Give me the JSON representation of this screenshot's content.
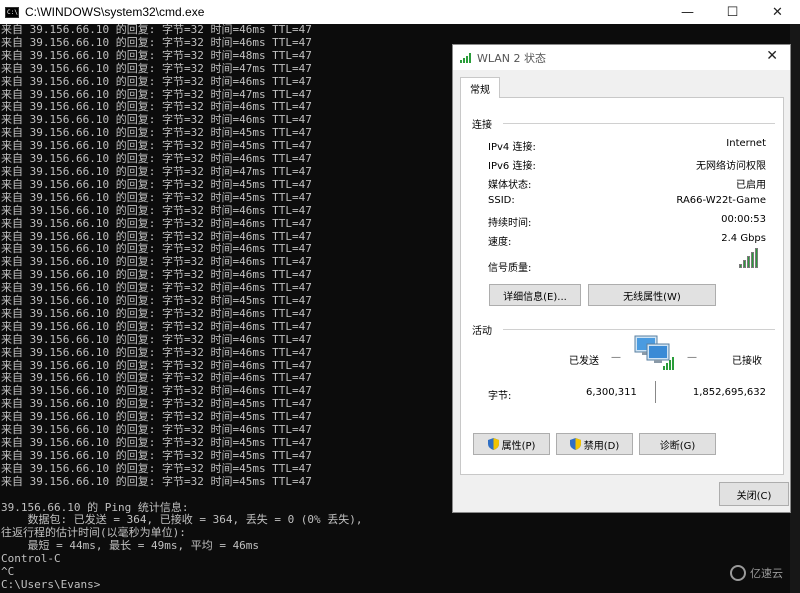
{
  "cmd": {
    "title": "C:\\WINDOWS\\system32\\cmd.exe",
    "icon_text": "C:\\",
    "min": "—",
    "max": "☐",
    "close": "✕",
    "output": "来自 39.156.66.10 的回复: 字节=32 时间=46ms TTL=47\n来自 39.156.66.10 的回复: 字节=32 时间=46ms TTL=47\n来自 39.156.66.10 的回复: 字节=32 时间=48ms TTL=47\n来自 39.156.66.10 的回复: 字节=32 时间=47ms TTL=47\n来自 39.156.66.10 的回复: 字节=32 时间=46ms TTL=47\n来自 39.156.66.10 的回复: 字节=32 时间=47ms TTL=47\n来自 39.156.66.10 的回复: 字节=32 时间=46ms TTL=47\n来自 39.156.66.10 的回复: 字节=32 时间=46ms TTL=47\n来自 39.156.66.10 的回复: 字节=32 时间=45ms TTL=47\n来自 39.156.66.10 的回复: 字节=32 时间=45ms TTL=47\n来自 39.156.66.10 的回复: 字节=32 时间=46ms TTL=47\n来自 39.156.66.10 的回复: 字节=32 时间=47ms TTL=47\n来自 39.156.66.10 的回复: 字节=32 时间=45ms TTL=47\n来自 39.156.66.10 的回复: 字节=32 时间=45ms TTL=47\n来自 39.156.66.10 的回复: 字节=32 时间=46ms TTL=47\n来自 39.156.66.10 的回复: 字节=32 时间=46ms TTL=47\n来自 39.156.66.10 的回复: 字节=32 时间=46ms TTL=47\n来自 39.156.66.10 的回复: 字节=32 时间=46ms TTL=47\n来自 39.156.66.10 的回复: 字节=32 时间=46ms TTL=47\n来自 39.156.66.10 的回复: 字节=32 时间=46ms TTL=47\n来自 39.156.66.10 的回复: 字节=32 时间=46ms TTL=47\n来自 39.156.66.10 的回复: 字节=32 时间=45ms TTL=47\n来自 39.156.66.10 的回复: 字节=32 时间=46ms TTL=47\n来自 39.156.66.10 的回复: 字节=32 时间=46ms TTL=47\n来自 39.156.66.10 的回复: 字节=32 时间=46ms TTL=47\n来自 39.156.66.10 的回复: 字节=32 时间=46ms TTL=47\n来自 39.156.66.10 的回复: 字节=32 时间=46ms TTL=47\n来自 39.156.66.10 的回复: 字节=32 时间=46ms TTL=47\n来自 39.156.66.10 的回复: 字节=32 时间=46ms TTL=47\n来自 39.156.66.10 的回复: 字节=32 时间=45ms TTL=47\n来自 39.156.66.10 的回复: 字节=32 时间=45ms TTL=47\n来自 39.156.66.10 的回复: 字节=32 时间=46ms TTL=47\n来自 39.156.66.10 的回复: 字节=32 时间=45ms TTL=47\n来自 39.156.66.10 的回复: 字节=32 时间=45ms TTL=47\n来自 39.156.66.10 的回复: 字节=32 时间=45ms TTL=47\n来自 39.156.66.10 的回复: 字节=32 时间=45ms TTL=47\n\n39.156.66.10 的 Ping 统计信息:\n    数据包: 已发送 = 364, 已接收 = 364, 丢失 = 0 (0% 丢失),\n往返行程的估计时间(以毫秒为单位):\n    最短 = 44ms, 最长 = 49ms, 平均 = 46ms\nControl-C\n^C\nC:\\Users\\Evans>"
  },
  "dialog": {
    "title": "WLAN 2 状态",
    "close": "✕",
    "tab": "常规",
    "connection_header": "连接",
    "rows": [
      {
        "label": "IPv4 连接:",
        "value": "Internet"
      },
      {
        "label": "IPv6 连接:",
        "value": "无网络访问权限"
      },
      {
        "label": "媒体状态:",
        "value": "已启用"
      },
      {
        "label": "SSID:",
        "value": "RA66-W22t-Game"
      },
      {
        "label": "持续时间:",
        "value": "00:00:53"
      },
      {
        "label": "速度:",
        "value": "2.4 Gbps"
      }
    ],
    "signal_label": "信号质量:",
    "signal_level": 5,
    "details_btn": "详细信息(E)...",
    "wireless_btn": "无线属性(W)",
    "activity_header": "活动",
    "sent_label": "已发送",
    "received_label": "已接收",
    "dash": "—",
    "bytes_label": "字节:",
    "bytes_sent": "6,300,311",
    "bytes_received": "1,852,695,632",
    "properties_btn": "属性(P)",
    "disable_btn": "禁用(D)",
    "diagnose_btn": "诊断(G)",
    "close_btn": "关闭(C)",
    "accent": "#2a9d3a"
  },
  "watermark": {
    "text": "亿速云"
  }
}
